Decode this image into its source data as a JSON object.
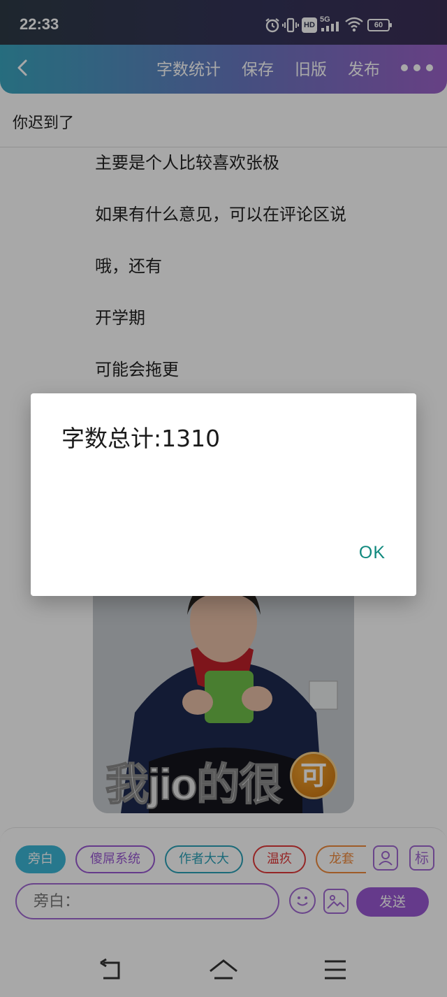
{
  "status_bar": {
    "time": "22:33",
    "battery": "60",
    "network": "5G",
    "hd_badge": "HD",
    "icons": [
      "alarm-icon",
      "vibrate-icon",
      "hd-icon",
      "signal-icon",
      "wifi-icon",
      "battery-icon"
    ]
  },
  "header": {
    "back_icon": "chevron-left-icon",
    "actions": [
      "字数统计",
      "保存",
      "旧版",
      "发布"
    ],
    "more_icon": "more-horizontal-icon",
    "gradient": [
      "#3ba6c0",
      "#6a78c2",
      "#9c62c8"
    ]
  },
  "chapter": {
    "title": "你迟到了",
    "lines": [
      "主要是个人比较喜欢张极",
      "如果有什么意见，可以在评论区说",
      "哦，还有",
      "开学期",
      "可能会拖更"
    ]
  },
  "meme": {
    "caption": "我jio的很",
    "badge": "可"
  },
  "input_bar": {
    "chips": [
      "旁白",
      "傻屌系统",
      "作者大大",
      "温疚",
      "龙套"
    ],
    "person_icon": "person-icon",
    "mark_label": "标",
    "placeholder": "旁白：",
    "emoji_icon": "emoji-icon",
    "image_icon": "image-icon",
    "send_label": "发送",
    "accent": "#9a58d4"
  },
  "nav_bar": {
    "icons": [
      "back-nav-icon",
      "home-nav-icon",
      "menu-nav-icon"
    ]
  },
  "dialog": {
    "message": "字数总计:1310",
    "ok_label": "OK",
    "ok_color": "#10897e"
  }
}
